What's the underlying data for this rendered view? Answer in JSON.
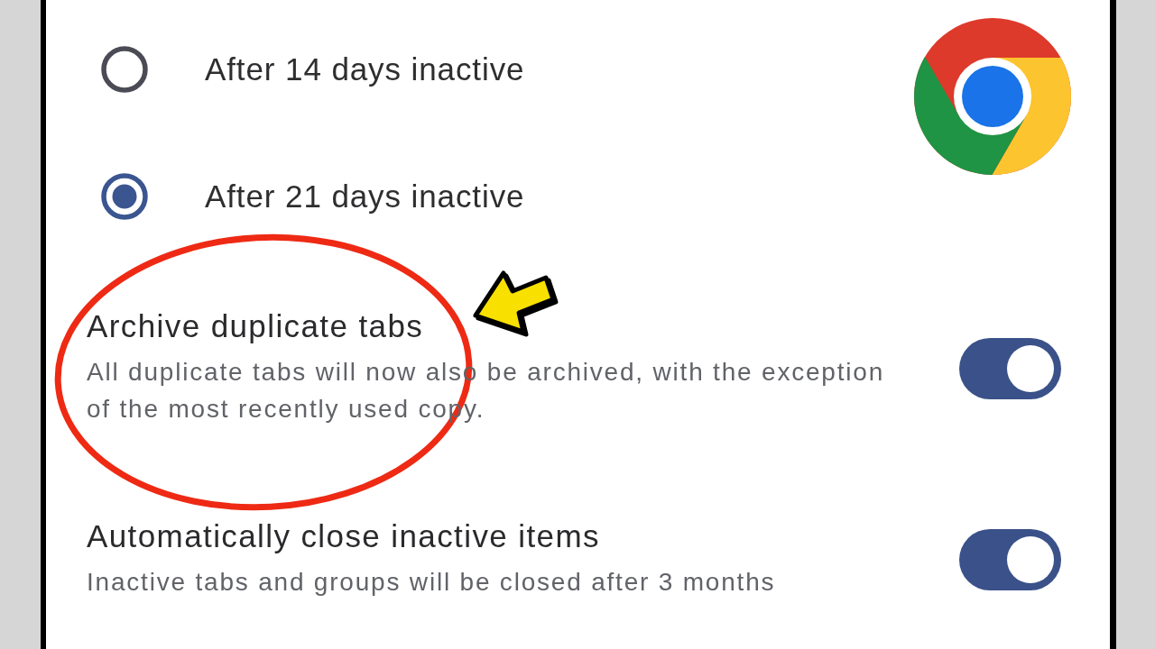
{
  "options": [
    {
      "label": "After 14 days inactive",
      "selected": false
    },
    {
      "label": "After 21 days inactive",
      "selected": true
    }
  ],
  "settings": [
    {
      "title": "Archive duplicate tabs",
      "description": "All duplicate tabs will now also be archived, with the exception of the most recently used copy.",
      "on": true
    },
    {
      "title": "Automatically close inactive items",
      "description": "Inactive tabs and groups will be closed after 3 months",
      "on": true
    }
  ],
  "annotations": [
    {
      "kind": "ellipse"
    },
    {
      "kind": "arrow"
    }
  ]
}
